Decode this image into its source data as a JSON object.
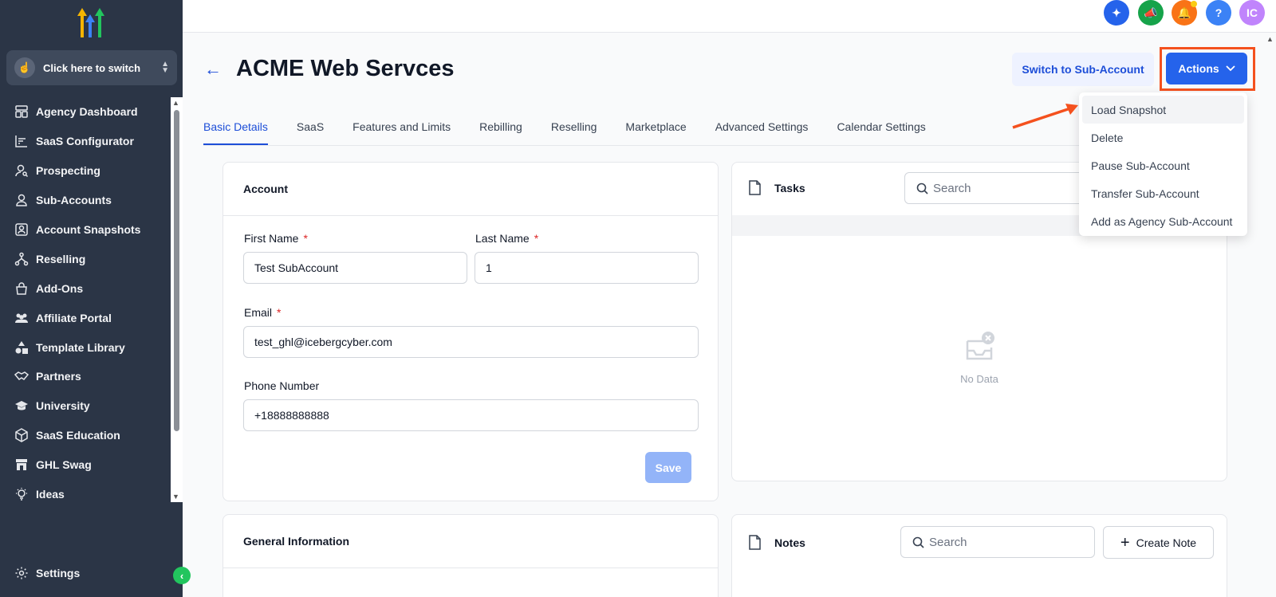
{
  "sidebar": {
    "switcher_label": "Click here to switch",
    "items": [
      {
        "label": "Agency Dashboard",
        "icon": "dashboard-icon"
      },
      {
        "label": "SaaS Configurator",
        "icon": "chart-icon"
      },
      {
        "label": "Prospecting",
        "icon": "user-search-icon"
      },
      {
        "label": "Sub-Accounts",
        "icon": "user-icon"
      },
      {
        "label": "Account Snapshots",
        "icon": "snapshot-icon"
      },
      {
        "label": "Reselling",
        "icon": "network-icon"
      },
      {
        "label": "Add-Ons",
        "icon": "bag-icon"
      },
      {
        "label": "Affiliate Portal",
        "icon": "users-icon"
      },
      {
        "label": "Template Library",
        "icon": "shapes-icon"
      },
      {
        "label": "Partners",
        "icon": "handshake-icon"
      },
      {
        "label": "University",
        "icon": "graduation-icon"
      },
      {
        "label": "SaaS Education",
        "icon": "cube-icon"
      },
      {
        "label": "GHL Swag",
        "icon": "store-icon"
      },
      {
        "label": "Ideas",
        "icon": "lightbulb-icon"
      }
    ],
    "settings_label": "Settings"
  },
  "topbar": {
    "avatar_initials": "IC",
    "help_label": "?",
    "colors": {
      "magic": "#2563eb",
      "announce": "#16a34a",
      "notify": "#f97316",
      "help": "#3b82f6",
      "avatar": "#c084fc"
    }
  },
  "header": {
    "title": "ACME Web Servces",
    "switch_label": "Switch to Sub-Account",
    "actions_label": "Actions"
  },
  "tabs": [
    "Basic Details",
    "SaaS",
    "Features and Limits",
    "Rebilling",
    "Reselling",
    "Marketplace",
    "Advanced Settings",
    "Calendar Settings"
  ],
  "account": {
    "title": "Account",
    "first_name_label": "First Name",
    "first_name_value": "Test SubAccount",
    "last_name_label": "Last Name",
    "last_name_value": "1",
    "email_label": "Email",
    "email_value": "test_ghl@icebergcyber.com",
    "phone_label": "Phone Number",
    "phone_value": "+18888888888",
    "required_mark": "*",
    "save_label": "Save"
  },
  "general": {
    "title": "General Information"
  },
  "tasks": {
    "title": "Tasks",
    "search_placeholder": "Search",
    "empty_text": "No Data"
  },
  "notes": {
    "title": "Notes",
    "search_placeholder": "Search",
    "create_label": "Create Note"
  },
  "dropdown": {
    "items": [
      "Load Snapshot",
      "Delete",
      "Pause Sub-Account",
      "Transfer Sub-Account",
      "Add as Agency Sub-Account"
    ]
  },
  "accent_colors": {
    "highlight": "#f4511e",
    "primary": "#2563eb"
  }
}
